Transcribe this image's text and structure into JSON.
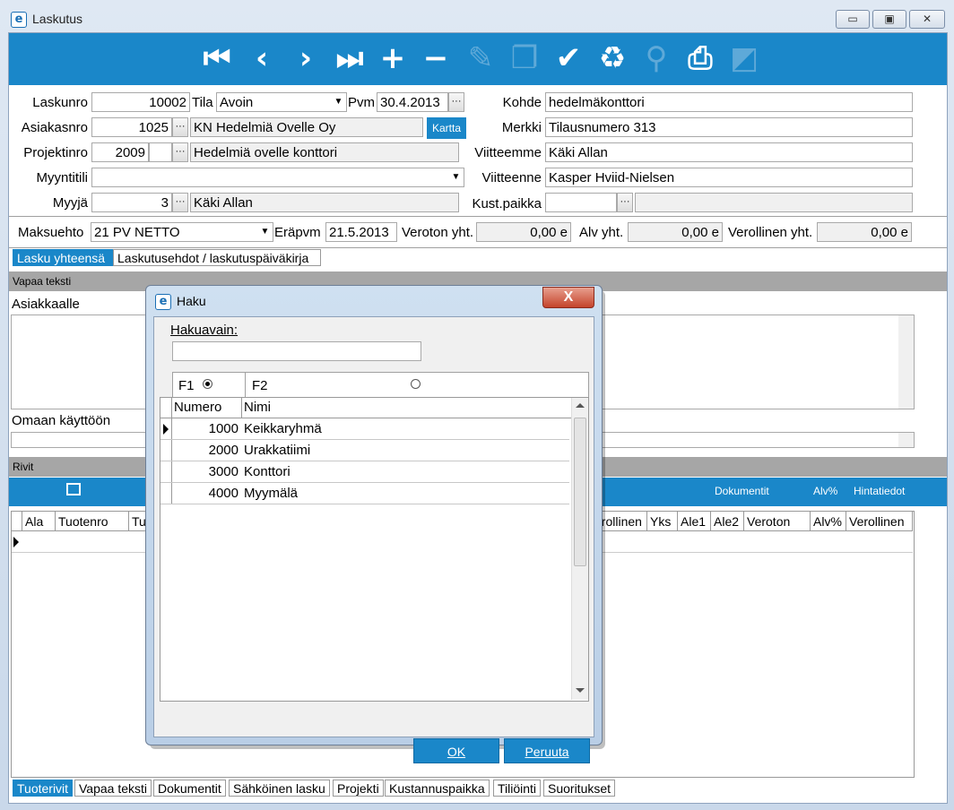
{
  "window": {
    "title": "Laskutus",
    "logo_glyph": "e",
    "minimize_glyph": "▭",
    "maximize_glyph": "▣",
    "close_glyph": "✕"
  },
  "toolbar": {
    "icons": [
      {
        "name": "first-record-icon",
        "glyph": "⏮"
      },
      {
        "name": "previous-record-icon",
        "glyph": "‹"
      },
      {
        "name": "next-record-icon",
        "glyph": "›"
      },
      {
        "name": "last-record-icon",
        "glyph": "⏭"
      },
      {
        "name": "add-icon",
        "glyph": "+"
      },
      {
        "name": "remove-icon",
        "glyph": "−"
      },
      {
        "name": "edit-pencil-icon",
        "glyph": "✎"
      },
      {
        "name": "copy-icon",
        "glyph": "❐"
      },
      {
        "name": "save-checkmark-icon",
        "glyph": "✔"
      },
      {
        "name": "recycle-bin-icon",
        "glyph": "♻"
      },
      {
        "name": "flashlight-icon",
        "glyph": "⚲"
      },
      {
        "name": "print-icon",
        "glyph": "⎙"
      },
      {
        "name": "outlook-icon",
        "glyph": "◩"
      }
    ]
  },
  "header": {
    "laskunro_label": "Laskunro",
    "laskunro": "10002",
    "tila_label": "Tila",
    "tila": "Avoin",
    "pvm_label": "Pvm",
    "pvm": "30.4.2013",
    "kohde_label": "Kohde",
    "kohde": "hedelmäkonttori",
    "asiakasnro_label": "Asiakasnro",
    "asiakasnro": "1025",
    "asiakas_nimi": "KN Hedelmiä Ovelle Oy",
    "kartta_label": "Kartta",
    "merkki_label": "Merkki",
    "merkki": "Tilausnumero 313",
    "projektinro_label": "Projektinro",
    "projektinro": "2009",
    "projekti_nimi": "Hedelmiä ovelle konttori",
    "viitteemme_label": "Viitteemme",
    "viitteemme": "Käki Allan",
    "myyntitili_label": "Myyntitili",
    "myyntitili": "",
    "viitteenne_label": "Viitteenne",
    "viitteenne": "Kasper Hviid-Nielsen",
    "myyja_label": "Myyjä",
    "myyja": "3",
    "myyja_nimi": "Käki Allan",
    "kustpaikka_label": "Kust.paikka",
    "kustpaikka": "",
    "kustpaikka_nimi": "",
    "ellipsis": "···",
    "dropdown_glyph": "▼"
  },
  "totals": {
    "maksuehto_label": "Maksuehto",
    "maksuehto": "21 PV NETTO",
    "erapvm_label": "Eräpvm",
    "erapvm": "21.5.2013",
    "veroton_label": "Veroton yht.",
    "veroton": "0,00 e",
    "alv_label": "Alv yht.",
    "alv": "0,00 e",
    "verollinen_label": "Verollinen yht.",
    "verollinen": "0,00 e"
  },
  "tabs_top": [
    "Lasku yhteensä",
    "Laskutusehdot / laskutuspäiväkirja"
  ],
  "vapaa_teksti": {
    "section_label": "Vapaa teksti",
    "asiakkaalle_label": "Asiakkaalle",
    "omaan_label": "Omaan käyttöön"
  },
  "rivit": {
    "section_label": "Rivit",
    "dokumentit_label": "Dokumentit",
    "alv_label": "Alv%",
    "hintatiedot_label": "Hintatiedot",
    "columns_left": [
      "Ala",
      "Tuotenro",
      "Tu"
    ],
    "columns_right": [
      "erollinen",
      "Yks",
      "Ale1",
      "Ale2",
      "Veroton",
      "Alv%",
      "Verollinen"
    ]
  },
  "tabs_bottom": [
    "Tuoterivit",
    "Vapaa teksti",
    "Dokumentit",
    "Sähköinen lasku",
    "Projekti",
    "Kustannuspaikka",
    "Tiliöinti",
    "Suoritukset"
  ],
  "dialog": {
    "title": "Haku",
    "hakuavain_label": "Hakuavain:",
    "hakuavain_value": "",
    "f1_label": "F1",
    "f2_label": "F2",
    "col_numero": "Numero",
    "col_nimi": "Nimi",
    "rows": [
      {
        "numero": "1000",
        "nimi": "Keikkaryhmä"
      },
      {
        "numero": "2000",
        "nimi": "Urakkatiimi"
      },
      {
        "numero": "3000",
        "nimi": "Konttori"
      },
      {
        "numero": "4000",
        "nimi": "Myymälä"
      }
    ],
    "ok_label": "OK",
    "cancel_label": "Peruuta",
    "close_glyph": "X"
  }
}
